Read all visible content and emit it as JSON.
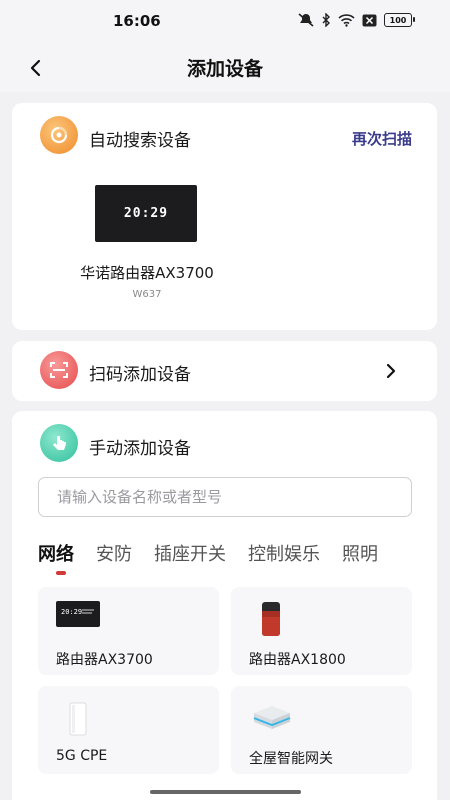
{
  "status_bar": {
    "time": "16:06",
    "battery": "100"
  },
  "nav": {
    "title": "添加设备"
  },
  "auto_search": {
    "title": "自动搜索设备",
    "rescan_label": "再次扫描",
    "device": {
      "display_time": "20:29",
      "name": "华诺路由器AX3700",
      "model": "W637"
    }
  },
  "scan_add": {
    "title": "扫码添加设备"
  },
  "manual_add": {
    "title": "手动添加设备",
    "search_placeholder": "请输入设备名称或者型号",
    "tabs": [
      {
        "label": "网络",
        "active": true
      },
      {
        "label": "安防",
        "active": false
      },
      {
        "label": "插座开关",
        "active": false
      },
      {
        "label": "控制娱乐",
        "active": false
      },
      {
        "label": "照明",
        "active": false
      }
    ],
    "devices": [
      {
        "name": "路由器AX3700",
        "icon": "router-ax3700-icon"
      },
      {
        "name": "路由器AX1800",
        "icon": "router-ax1800-icon"
      },
      {
        "name": "5G CPE",
        "icon": "5g-cpe-icon"
      },
      {
        "name": "全屋智能网关",
        "icon": "smart-gateway-icon"
      }
    ]
  },
  "colors": {
    "accent_link": "#3b3c8c",
    "tab_indicator": "#d23a3a",
    "auto_icon": "#f39a3c",
    "scan_icon": "#ee5b5b",
    "manual_icon": "#3cc9a8"
  }
}
